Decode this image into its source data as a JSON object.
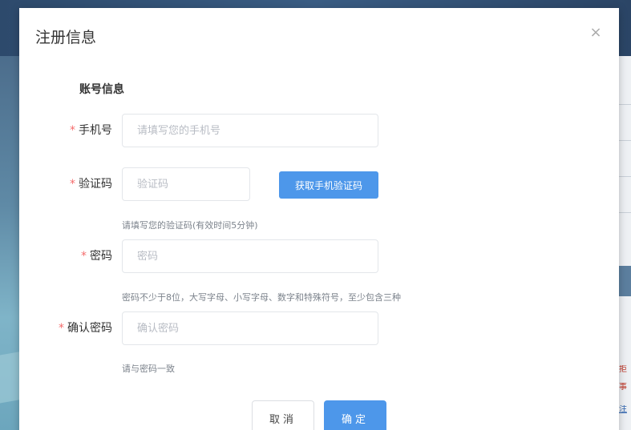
{
  "dialog": {
    "title": "注册信息",
    "close_icon": "×",
    "section_title": "账号信息"
  },
  "form": {
    "phone": {
      "required_mark": "*",
      "label": "手机号",
      "placeholder": "请填写您的手机号",
      "value": ""
    },
    "code": {
      "required_mark": "*",
      "label": "验证码",
      "placeholder": "验证码",
      "value": "",
      "get_code_label": "获取手机验证码",
      "hint": "请填写您的验证码(有效时间5分钟)"
    },
    "password": {
      "required_mark": "*",
      "label": "密码",
      "placeholder": "密码",
      "value": "",
      "hint": "密码不少于8位，大写字母、小写字母、数字和特殊符号，至少包含三种"
    },
    "confirm_password": {
      "required_mark": "*",
      "label": "确认密码",
      "placeholder": "确认密码",
      "value": "",
      "hint": "请与密码一致"
    }
  },
  "actions": {
    "cancel_label": "取消",
    "ok_label": "确定"
  },
  "background_page": {
    "right_text_1": "拒",
    "right_text_2": "事",
    "right_link": "注",
    "colors": {
      "accent": "#4d97ea",
      "required": "#f56c6c"
    }
  }
}
